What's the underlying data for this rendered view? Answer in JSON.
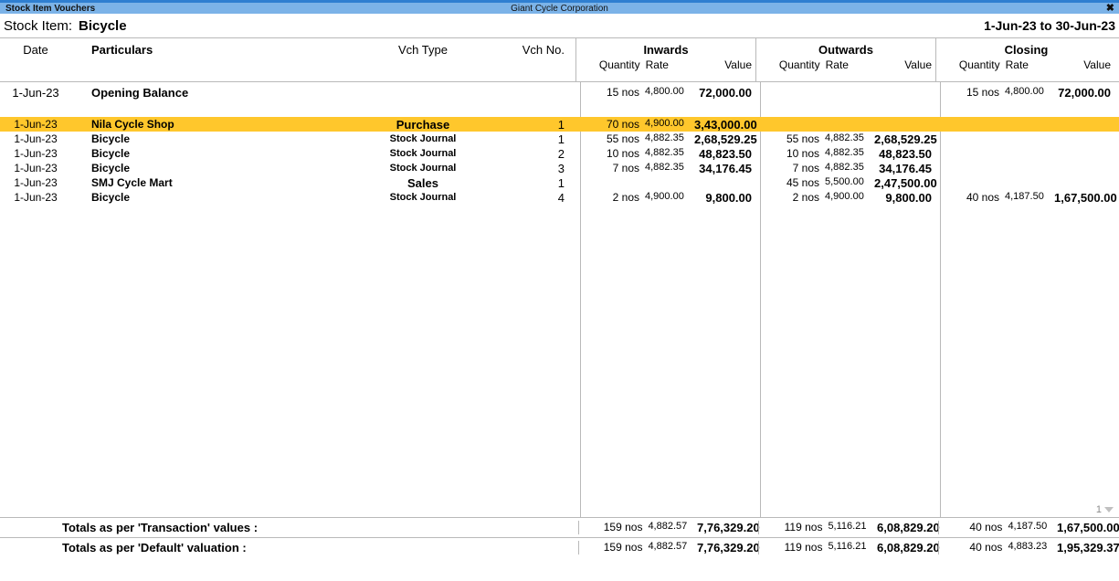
{
  "titlebar": {
    "left_title": "Stock Item Vouchers",
    "company": "Giant Cycle Corporation",
    "close_label": "✖"
  },
  "report": {
    "stock_item_label": "Stock Item:",
    "stock_item_value": "Bicycle",
    "period": "1-Jun-23 to 30-Jun-23"
  },
  "colors": {
    "titlebar_bg": "#7CB3E8",
    "titlebar_top": "#2F7FD1",
    "highlight_row": "#FFC72C",
    "border": "#B9B9B9"
  },
  "columns": {
    "date": "Date",
    "particulars": "Particulars",
    "vch_type": "Vch Type",
    "vch_no": "Vch No.",
    "groups": [
      {
        "title": "Inwards",
        "quantity": "Quantity",
        "rate": "Rate",
        "value": "Value"
      },
      {
        "title": "Outwards",
        "quantity": "Quantity",
        "rate": "Rate",
        "value": "Value"
      },
      {
        "title": "Closing",
        "quantity": "Quantity",
        "rate": "Rate",
        "value": "Value"
      }
    ]
  },
  "opening": {
    "date": "1-Jun-23",
    "particulars": "Opening Balance",
    "vch_type": "",
    "vch_no": "",
    "inwards": {
      "quantity": "15 nos",
      "rate": "4,800.00",
      "value": "72,000.00"
    },
    "outwards": {
      "quantity": "",
      "rate": "",
      "value": ""
    },
    "closing": {
      "quantity": "15 nos",
      "rate": "4,800.00",
      "value": "72,000.00"
    }
  },
  "rows": [
    {
      "date": "1-Jun-23",
      "particulars": "Nila Cycle Shop",
      "vch_type": "Purchase",
      "vch_type_big": true,
      "vch_no": "1",
      "highlight": true,
      "inwards": {
        "quantity": "70 nos",
        "rate": "4,900.00",
        "value": "3,43,000.00"
      },
      "outwards": {
        "quantity": "",
        "rate": "",
        "value": ""
      },
      "closing": {
        "quantity": "",
        "rate": "",
        "value": ""
      }
    },
    {
      "date": "1-Jun-23",
      "particulars": "Bicycle",
      "vch_type": "Stock Journal",
      "vch_type_big": false,
      "vch_no": "1",
      "highlight": false,
      "inwards": {
        "quantity": "55 nos",
        "rate": "4,882.35",
        "value": "2,68,529.25"
      },
      "outwards": {
        "quantity": "55 nos",
        "rate": "4,882.35",
        "value": "2,68,529.25"
      },
      "closing": {
        "quantity": "",
        "rate": "",
        "value": ""
      }
    },
    {
      "date": "1-Jun-23",
      "particulars": "Bicycle",
      "vch_type": "Stock Journal",
      "vch_type_big": false,
      "vch_no": "2",
      "highlight": false,
      "inwards": {
        "quantity": "10 nos",
        "rate": "4,882.35",
        "value": "48,823.50"
      },
      "outwards": {
        "quantity": "10 nos",
        "rate": "4,882.35",
        "value": "48,823.50"
      },
      "closing": {
        "quantity": "",
        "rate": "",
        "value": ""
      }
    },
    {
      "date": "1-Jun-23",
      "particulars": "Bicycle",
      "vch_type": "Stock Journal",
      "vch_type_big": false,
      "vch_no": "3",
      "highlight": false,
      "inwards": {
        "quantity": "7 nos",
        "rate": "4,882.35",
        "value": "34,176.45"
      },
      "outwards": {
        "quantity": "7 nos",
        "rate": "4,882.35",
        "value": "34,176.45"
      },
      "closing": {
        "quantity": "",
        "rate": "",
        "value": ""
      }
    },
    {
      "date": "1-Jun-23",
      "particulars": "SMJ Cycle Mart",
      "vch_type": "Sales",
      "vch_type_big": true,
      "vch_no": "1",
      "highlight": false,
      "inwards": {
        "quantity": "",
        "rate": "",
        "value": ""
      },
      "outwards": {
        "quantity": "45 nos",
        "rate": "5,500.00",
        "value": "2,47,500.00"
      },
      "closing": {
        "quantity": "",
        "rate": "",
        "value": ""
      }
    },
    {
      "date": "1-Jun-23",
      "particulars": "Bicycle",
      "vch_type": "Stock Journal",
      "vch_type_big": false,
      "vch_no": "4",
      "highlight": false,
      "inwards": {
        "quantity": "2 nos",
        "rate": "4,900.00",
        "value": "9,800.00"
      },
      "outwards": {
        "quantity": "2 nos",
        "rate": "4,900.00",
        "value": "9,800.00"
      },
      "closing": {
        "quantity": "40 nos",
        "rate": "4,187.50",
        "value": "1,67,500.00"
      }
    }
  ],
  "page_indicator": {
    "number": "1",
    "caret": "down-caret"
  },
  "totals": [
    {
      "label": "Totals as per 'Transaction' values :",
      "inwards": {
        "quantity": "159 nos",
        "rate": "4,882.57",
        "value": "7,76,329.20"
      },
      "outwards": {
        "quantity": "119 nos",
        "rate": "5,116.21",
        "value": "6,08,829.20"
      },
      "closing": {
        "quantity": "40 nos",
        "rate": "4,187.50",
        "value": "1,67,500.00"
      }
    },
    {
      "label": "Totals as per 'Default' valuation :",
      "inwards": {
        "quantity": "159 nos",
        "rate": "4,882.57",
        "value": "7,76,329.20"
      },
      "outwards": {
        "quantity": "119 nos",
        "rate": "5,116.21",
        "value": "6,08,829.20"
      },
      "closing": {
        "quantity": "40 nos",
        "rate": "4,883.23",
        "value": "1,95,329.37"
      }
    }
  ]
}
